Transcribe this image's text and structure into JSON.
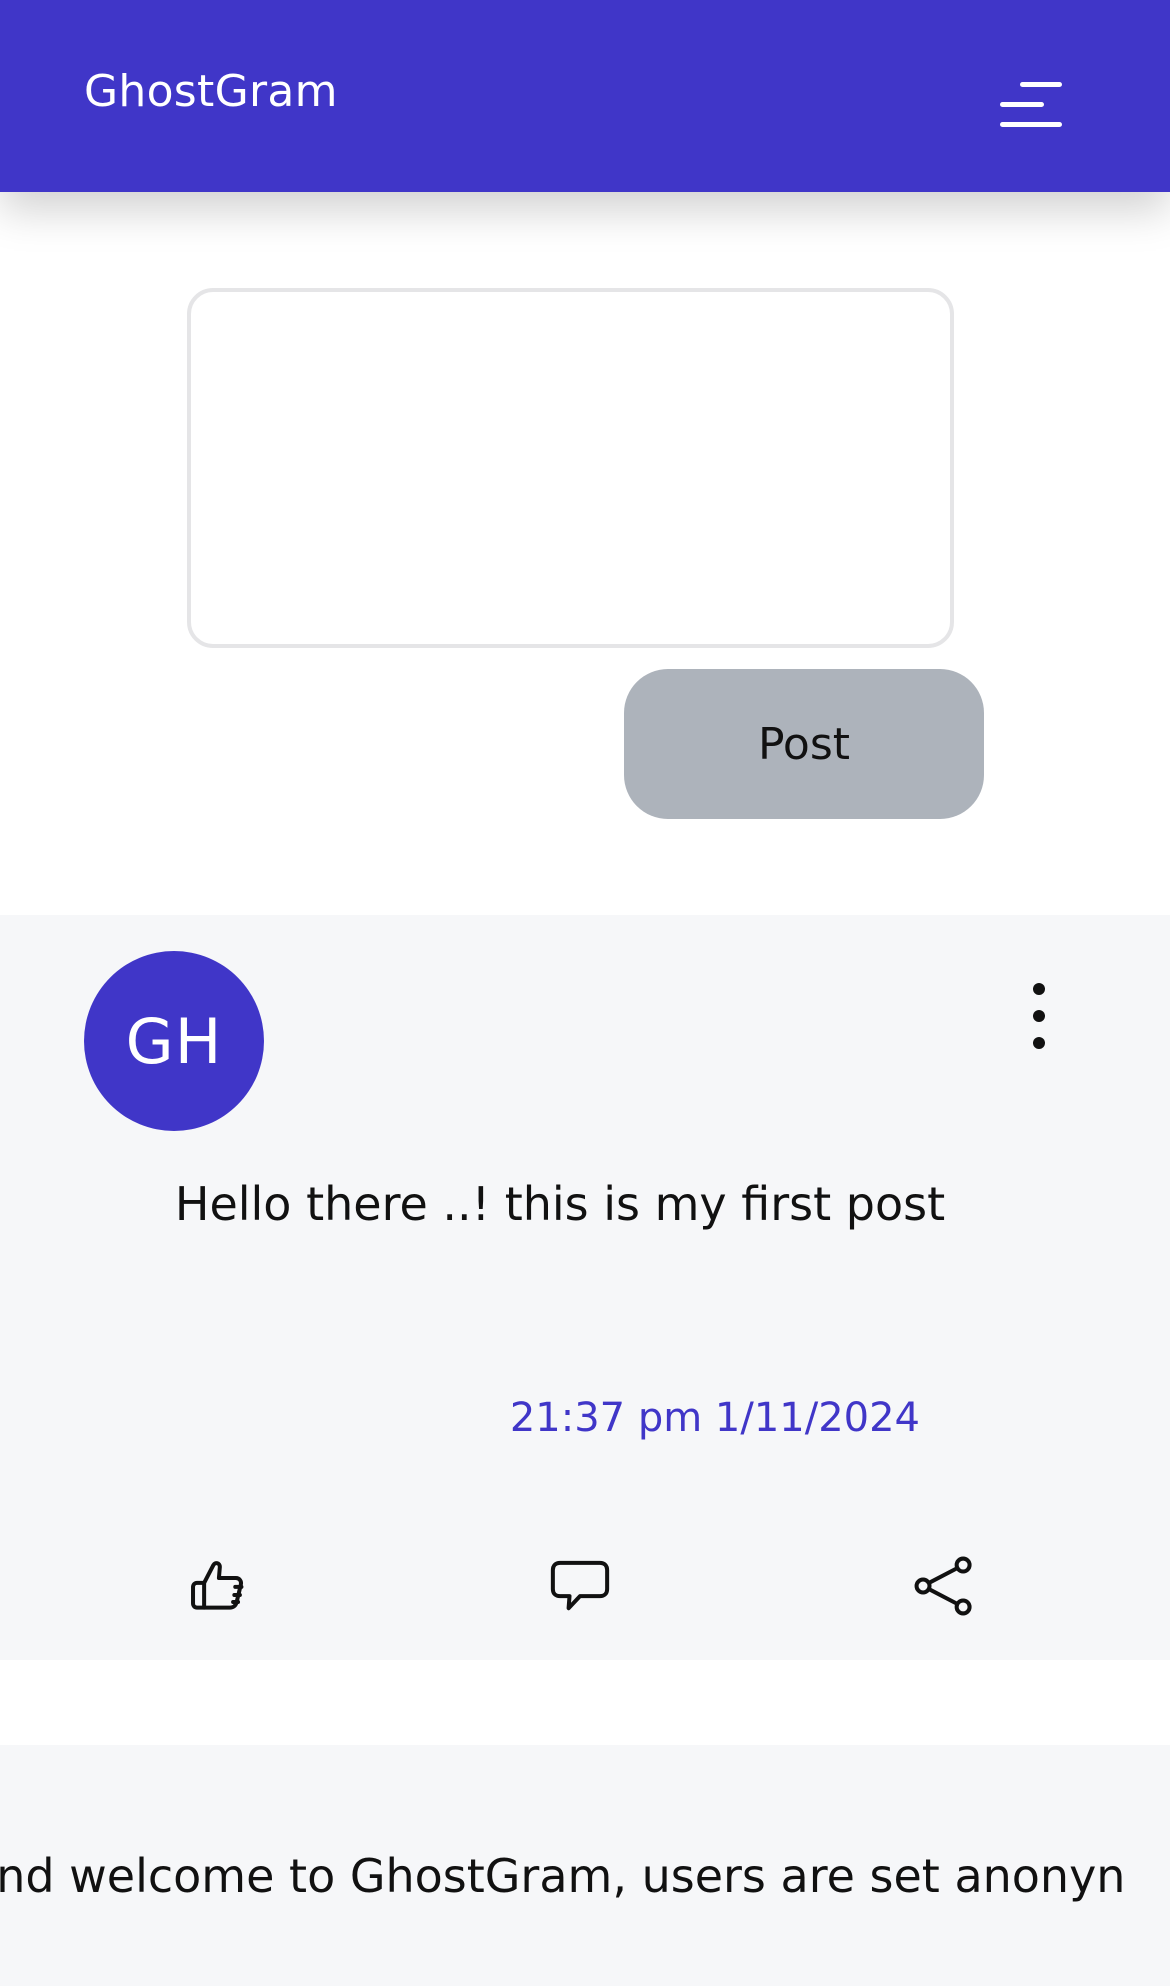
{
  "header": {
    "brand": "GhostGram",
    "menu_icon": "hamburger-menu-icon"
  },
  "composer": {
    "value": "",
    "placeholder": "",
    "post_label": "Post"
  },
  "posts": [
    {
      "avatar_initials": "GH",
      "more_icon": "vertical-dots-icon",
      "text": "Hello there ..! this is my first post",
      "timestamp": "21:37 pm 1/11/2024",
      "actions": {
        "like_icon": "thumbs-up-icon",
        "comment_icon": "speech-bubble-icon",
        "share_icon": "share-icon"
      }
    },
    {
      "text": "and welcome to GhostGram, users are set anonyn"
    }
  ],
  "colors": {
    "accent": "#4036c8",
    "button_gray": "#adb3bb",
    "card_bg": "#f6f7f9"
  }
}
